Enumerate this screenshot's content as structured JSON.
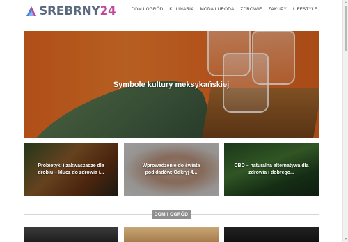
{
  "header": {
    "logo": {
      "text_main": "SREBRNY",
      "text_accent": "24"
    },
    "nav": [
      "DOM I OGRÓD",
      "KULINARIA",
      "MODA I URODA",
      "ZDROWIE",
      "ZAKUPY",
      "LIFESTYLE"
    ]
  },
  "hero": {
    "title": "Symbole kultury meksykańskiej"
  },
  "cards": [
    {
      "title": "Probiotyki i zakwaszacze dla drobiu – klucz do zdrowia i..."
    },
    {
      "title": "Wprowadzenie do świata podkładów: Odkryj 4..."
    },
    {
      "title": "CBD – naturalna alternatywa dla zdrowia i dobrego..."
    }
  ],
  "section": {
    "label": "DOM I OGRÓD"
  },
  "colors": {
    "brand_gray": "#5a6a7e",
    "brand_accent": "#c2479b",
    "hero_orange": "#e2651f",
    "section_label_bg": "#8f8f8f"
  }
}
